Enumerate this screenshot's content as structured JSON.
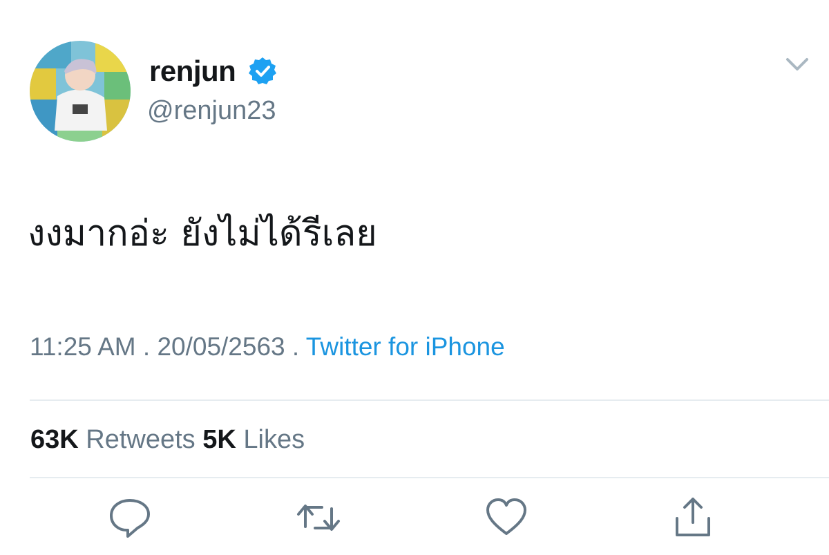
{
  "tweet": {
    "display_name": "renjun",
    "handle": "@renjun23",
    "verified": true,
    "text": "งงมากอ่ะ ยังไม่ได้รีเลย",
    "time": "11:25 AM",
    "date": "20/05/2563",
    "separator": " . ",
    "source": "Twitter for iPhone",
    "retweets_count": "63K",
    "retweets_label": "Retweets",
    "likes_count": "5K",
    "likes_label": "Likes"
  },
  "icons": {
    "verified": "verified-badge-icon",
    "more": "chevron-down-icon",
    "reply": "reply-icon",
    "retweet": "retweet-icon",
    "like": "heart-icon",
    "share": "share-icon"
  },
  "colors": {
    "primary_text": "#14171a",
    "secondary_text": "#657786",
    "link": "#1b95e0",
    "verified": "#1da1f2",
    "divider": "#e6ecf0",
    "icon": "#657786"
  }
}
